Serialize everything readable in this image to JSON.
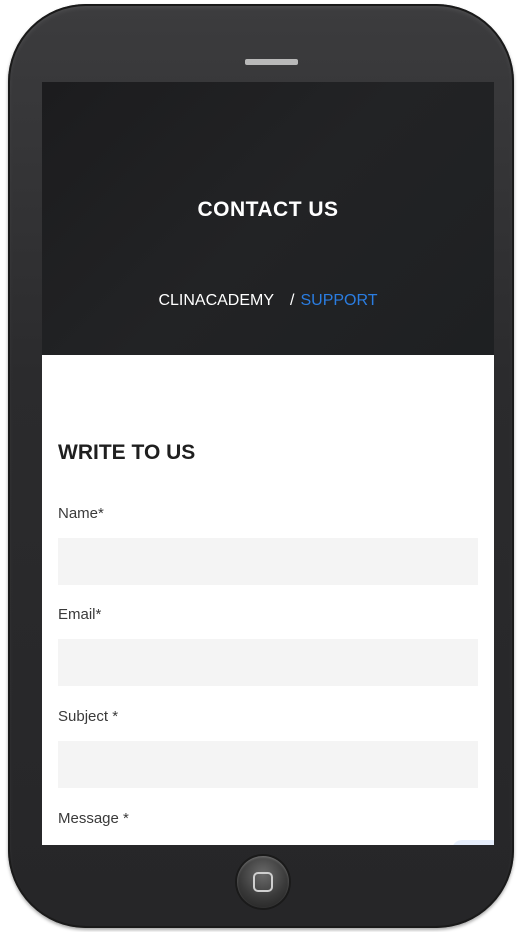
{
  "hero": {
    "title": "CONTACT US",
    "breadcrumb": {
      "root": "CLINACADEMY",
      "separator": "/",
      "current": "SUPPORT"
    }
  },
  "form": {
    "title": "WRITE TO US",
    "fields": [
      {
        "label": "Name*",
        "value": ""
      },
      {
        "label": "Email*",
        "value": ""
      },
      {
        "label": "Subject *",
        "value": ""
      },
      {
        "label": "Message *",
        "value": ""
      }
    ]
  },
  "colors": {
    "accent": "#2a7de1",
    "hero_bg": "#1f2022",
    "input_bg": "#f4f4f4",
    "device_body": "#2b2b2d"
  },
  "icons": {
    "home": "home-button-icon"
  }
}
